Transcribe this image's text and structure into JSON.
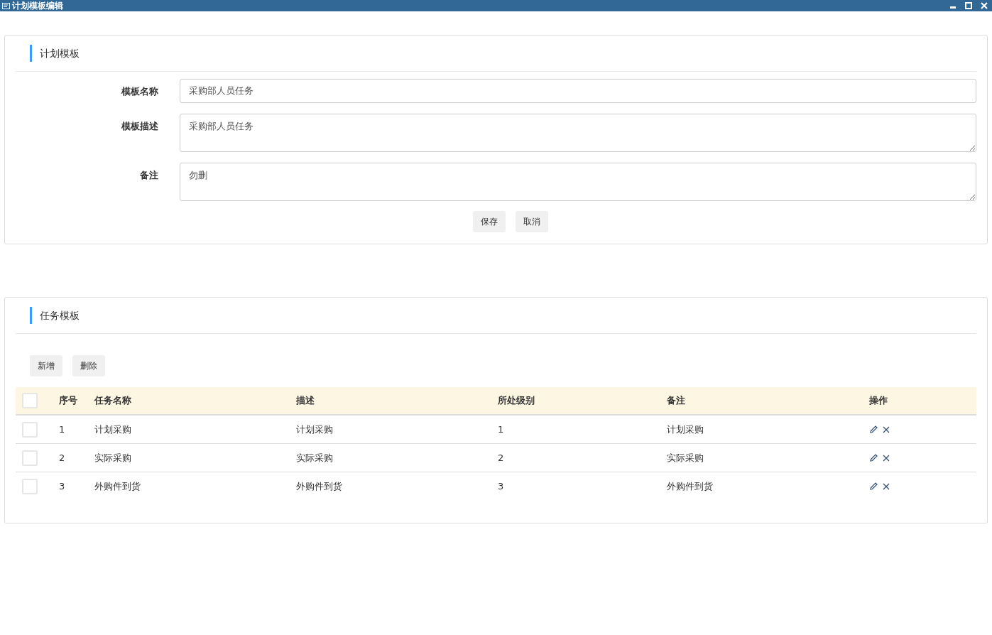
{
  "window": {
    "title": "计划模板编辑"
  },
  "plan_panel": {
    "title": "计划模板",
    "fields": [
      {
        "kind": "input",
        "label": "模板名称",
        "value": "采购部人员任务"
      },
      {
        "kind": "textarea",
        "label": "模板描述",
        "value": "采购部人员任务"
      },
      {
        "kind": "textarea",
        "label": "备注",
        "value": "勿删"
      }
    ],
    "buttons": [
      "保存",
      "取消"
    ]
  },
  "task_panel": {
    "title": "任务模板",
    "toolbar": [
      "新增",
      "删除"
    ],
    "table": {
      "select_all": {
        "checked": false
      },
      "columns": [
        "序号",
        "任务名称",
        "描述",
        "所处级别",
        "备注",
        "操作"
      ],
      "rows": [
        {
          "checked": false,
          "cells": [
            "1",
            "计划采购",
            "计划采购",
            "1",
            "计划采购"
          ]
        },
        {
          "checked": false,
          "cells": [
            "2",
            "实际采购",
            "实际采购",
            "2",
            "实际采购"
          ]
        },
        {
          "checked": false,
          "cells": [
            "3",
            "外购件到货",
            "外购件到货",
            "3",
            "外购件到货"
          ]
        }
      ]
    }
  }
}
